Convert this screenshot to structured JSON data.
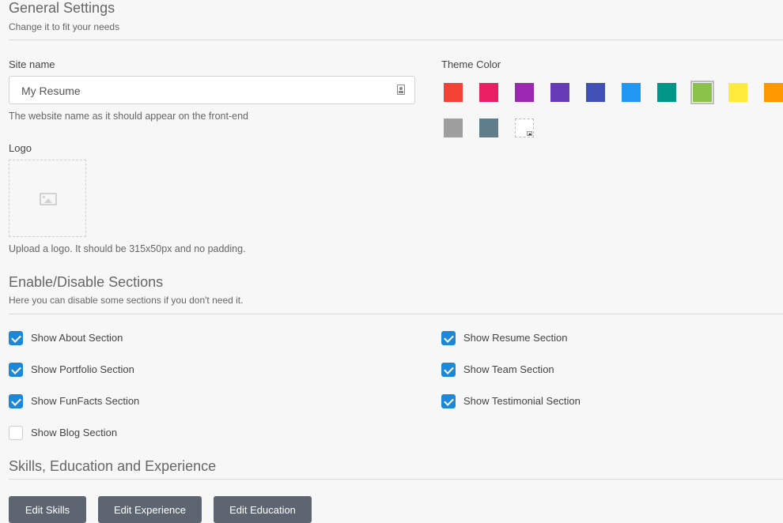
{
  "general": {
    "title": "General Settings",
    "subtitle": "Change it to fit your needs"
  },
  "site_name": {
    "label": "Site name",
    "value": "My Resume",
    "help": "The website name as it should appear on the front-end",
    "icon": "id-card-icon"
  },
  "theme": {
    "label": "Theme Color",
    "colors": [
      "#f44336",
      "#e91e63",
      "#9c27b0",
      "#673ab7",
      "#3f51b5",
      "#2196f3",
      "#009688",
      "#8bc34a",
      "#ffeb3b",
      "#ff9800",
      "#9e9e9e",
      "#607d8b"
    ],
    "selected": "#8bc34a"
  },
  "logo": {
    "label": "Logo",
    "help": "Upload a logo. It should be 315x50px and no padding.",
    "icon": "image-icon"
  },
  "sections": {
    "title": "Enable/Disable Sections",
    "subtitle": "Here you can disable some sections if you don't need it.",
    "items": [
      {
        "label": "Show About Section",
        "checked": true
      },
      {
        "label": "Show Portfolio Section",
        "checked": true
      },
      {
        "label": "Show FunFacts Section",
        "checked": true
      },
      {
        "label": "Show Blog Section",
        "checked": false
      },
      {
        "label": "Show Resume Section",
        "checked": true
      },
      {
        "label": "Show Team Section",
        "checked": true
      },
      {
        "label": "Show Testimonial Section",
        "checked": true
      }
    ]
  },
  "skills": {
    "title": "Skills, Education and Experience",
    "buttons": [
      "Edit Skills",
      "Edit Experience",
      "Edit Education"
    ]
  }
}
